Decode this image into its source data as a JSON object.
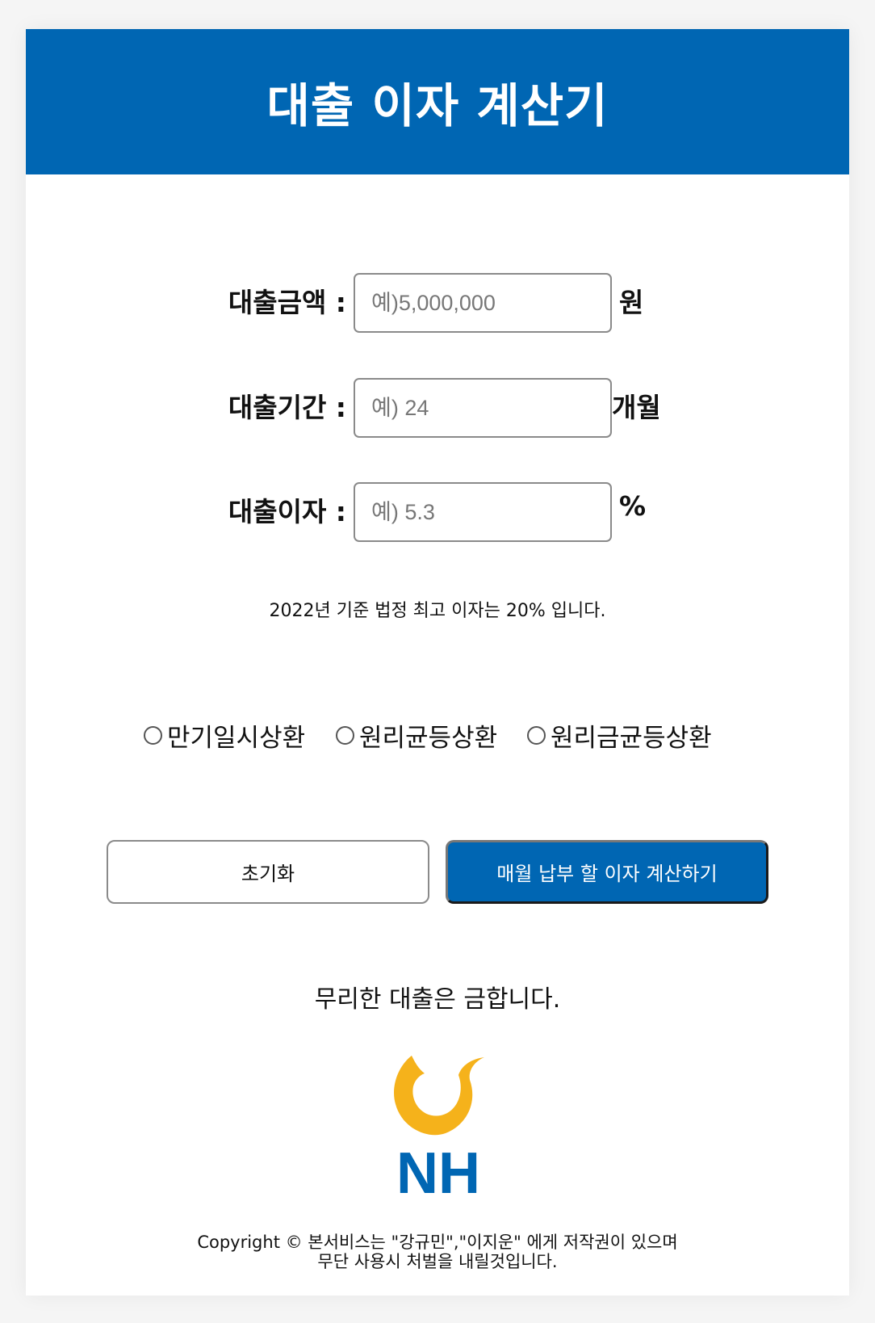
{
  "header": {
    "title": "대출 이자 계산기"
  },
  "form": {
    "amount": {
      "label": "대출금액 :",
      "placeholder": "예)5,000,000",
      "unit": "원"
    },
    "period": {
      "label": "대출기간 :",
      "placeholder": "예) 24",
      "unit": "개월"
    },
    "rate": {
      "label": "대출이자 :",
      "placeholder": "예) 5.3",
      "unit": "%"
    }
  },
  "note": "2022년 기준 법정 최고 이자는 20% 입니다.",
  "repayment_options": [
    {
      "label": "만기일시상환",
      "checked": false
    },
    {
      "label": "원리균등상환",
      "checked": false
    },
    {
      "label": "원리금균등상환",
      "checked": false
    }
  ],
  "buttons": {
    "reset": "초기화",
    "calculate": "매월 납부 할 이자 계산하기"
  },
  "warning": "무리한 대출은 금합니다.",
  "logo": {
    "text": "NH",
    "colors": {
      "blue": "#0066b3",
      "yellow": "#f5b21b"
    }
  },
  "footer": {
    "line1": "Copyright © 본서비스는 \"강규민\",\"이지운\" 에게 저작권이 있으며",
    "line2": "무단 사용시 처벌을 내릴것입니다."
  },
  "colors": {
    "primary": "#0066b3",
    "background": "#ffffff"
  }
}
